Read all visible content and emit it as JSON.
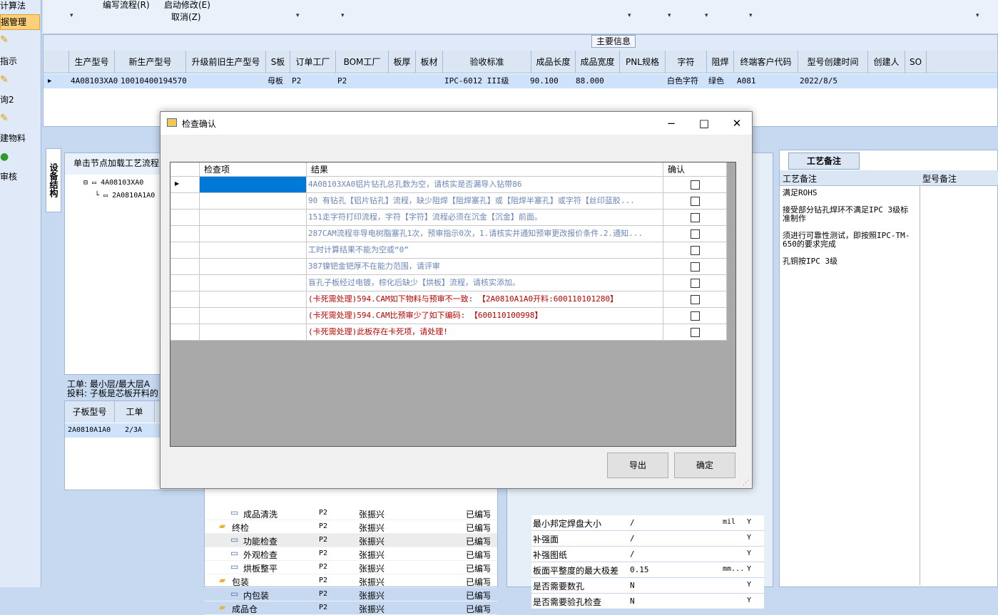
{
  "left_nav": {
    "items": [
      "计算法",
      "据管理",
      "指示",
      "询2",
      "建物料",
      "审核"
    ]
  },
  "toolbar": {
    "edit_flow": "编写流程(R)",
    "start_modify": "启动修改(E)",
    "cancel": "取消(Z)"
  },
  "main_grid": {
    "group_caption": "主要信息",
    "columns": [
      "生产型号",
      "新生产型号",
      "升级前旧生产型号",
      "S板",
      "订单工厂",
      "BOM工厂",
      "板厚",
      "板材",
      "验收标准",
      "成品长度",
      "成品宽度",
      "PNL规格",
      "字符",
      "阻焊",
      "终端客户代码",
      "型号创建时间",
      "创建人",
      "SO"
    ],
    "row": [
      "4A08103XA0",
      "10010400194570",
      "",
      "母板",
      "P2",
      "P2",
      "",
      "",
      "IPC-6012 III级",
      "90.100",
      "88.000",
      "",
      "白色字符",
      "绿色",
      "A081",
      "2022/8/5",
      "",
      ""
    ]
  },
  "left_panel": {
    "tab_label": "设备结构",
    "header": "单击节点加载工艺流程",
    "tree": [
      "4A08103XA0",
      "2A0810A1A0"
    ],
    "info_line1": "工单: 最小层/最大层A",
    "info_line2": "投料: 子板是芯板开料的",
    "sub_columns": [
      "子板型号",
      "工单"
    ],
    "sub_row": [
      "2A0810A1A0",
      "2/3A"
    ]
  },
  "flow_tree": {
    "rows": [
      {
        "name": "成品清洗",
        "factory": "P2",
        "person": "张振兴",
        "status": "已编写"
      },
      {
        "name": "终检",
        "factory": "P2",
        "person": "张振兴",
        "status": "已编写"
      },
      {
        "name": "功能检查",
        "factory": "P2",
        "person": "张振兴",
        "status": "已编写"
      },
      {
        "name": "外观检查",
        "factory": "P2",
        "person": "张振兴",
        "status": "已编写"
      },
      {
        "name": "烘板整平",
        "factory": "P2",
        "person": "张振兴",
        "status": "已编写"
      },
      {
        "name": "包装",
        "factory": "P2",
        "person": "张振兴",
        "status": "已编写"
      },
      {
        "name": "内包装",
        "factory": "P2",
        "person": "张振兴",
        "status": "已编写"
      },
      {
        "name": "成品仓",
        "factory": "P2",
        "person": "张振兴",
        "status": "已编写"
      }
    ]
  },
  "param_grid": {
    "rows": [
      {
        "name": "最小邦定焊盘大小",
        "value": "/",
        "unit": "mil",
        "flag": "Y"
      },
      {
        "name": "补强面",
        "value": "/",
        "unit": "",
        "flag": "Y"
      },
      {
        "name": "补强图纸",
        "value": "/",
        "unit": "",
        "flag": "Y"
      },
      {
        "name": "板面平整度的最大极差",
        "value": "0.15",
        "unit": "mm...",
        "flag": "Y"
      },
      {
        "name": "是否需要数孔",
        "value": "N",
        "unit": "",
        "flag": "Y"
      },
      {
        "name": "是否需要验孔检查",
        "value": "N",
        "unit": "",
        "flag": "Y"
      }
    ]
  },
  "craft_panel": {
    "tab": "工艺备注",
    "col1": "工艺备注",
    "col2": "型号备注",
    "notes": [
      "满足ROHS",
      "接受部分钻孔焊环不满足IPC 3级标准制作",
      "须进行可靠性测试，即按照IPC-TM-650的要求完成",
      "孔铜按IPC 3级"
    ]
  },
  "dialog": {
    "title": "检查确认",
    "columns": [
      "检查项",
      "结果",
      "确认"
    ],
    "rows": [
      {
        "item": "",
        "result": "4A08103XA0铝片钻孔总孔数为空，请核实是否漏导入钻带86",
        "level": "info"
      },
      {
        "item": "",
        "result": "90 有钻孔【铝片钻孔】流程，缺少阻焊【阻焊塞孔】或【阻焊半塞孔】或字符【丝印蓝胶...",
        "level": "info"
      },
      {
        "item": "",
        "result": "151走字符打印流程，字符【字符】流程必须在沉金【沉金】前面。",
        "level": "info"
      },
      {
        "item": "",
        "result": "287CAM流程非导电树脂塞孔1次，预审指示0次，1.请核实并通知预审更改报价条件.2.通知...",
        "level": "info"
      },
      {
        "item": "",
        "result": "工时计算结果不能为空或“0”",
        "level": "info"
      },
      {
        "item": "",
        "result": "387镍钯金钯厚不在能力范围，请评审",
        "level": "info"
      },
      {
        "item": "",
        "result": "盲孔子板经过电镀，棕化后缺少【烘板】流程，请核实添加。",
        "level": "info"
      },
      {
        "item": "",
        "result": "(卡死需处理)594.CAM如下物料与预审不一致: 【2A0810A1A0开料:600110101280】",
        "level": "error"
      },
      {
        "item": "",
        "result": "(卡死需处理)594.CAM比预审少了如下编码: 【600110100998】",
        "level": "error"
      },
      {
        "item": "",
        "result": "(卡死需处理)此板存在卡死项，请处理!",
        "level": "error"
      }
    ],
    "export_label": "导出",
    "ok_label": "确定"
  },
  "colors": {
    "info": "#6b86b8",
    "error": "#c00000",
    "selected": "#0078d7"
  }
}
